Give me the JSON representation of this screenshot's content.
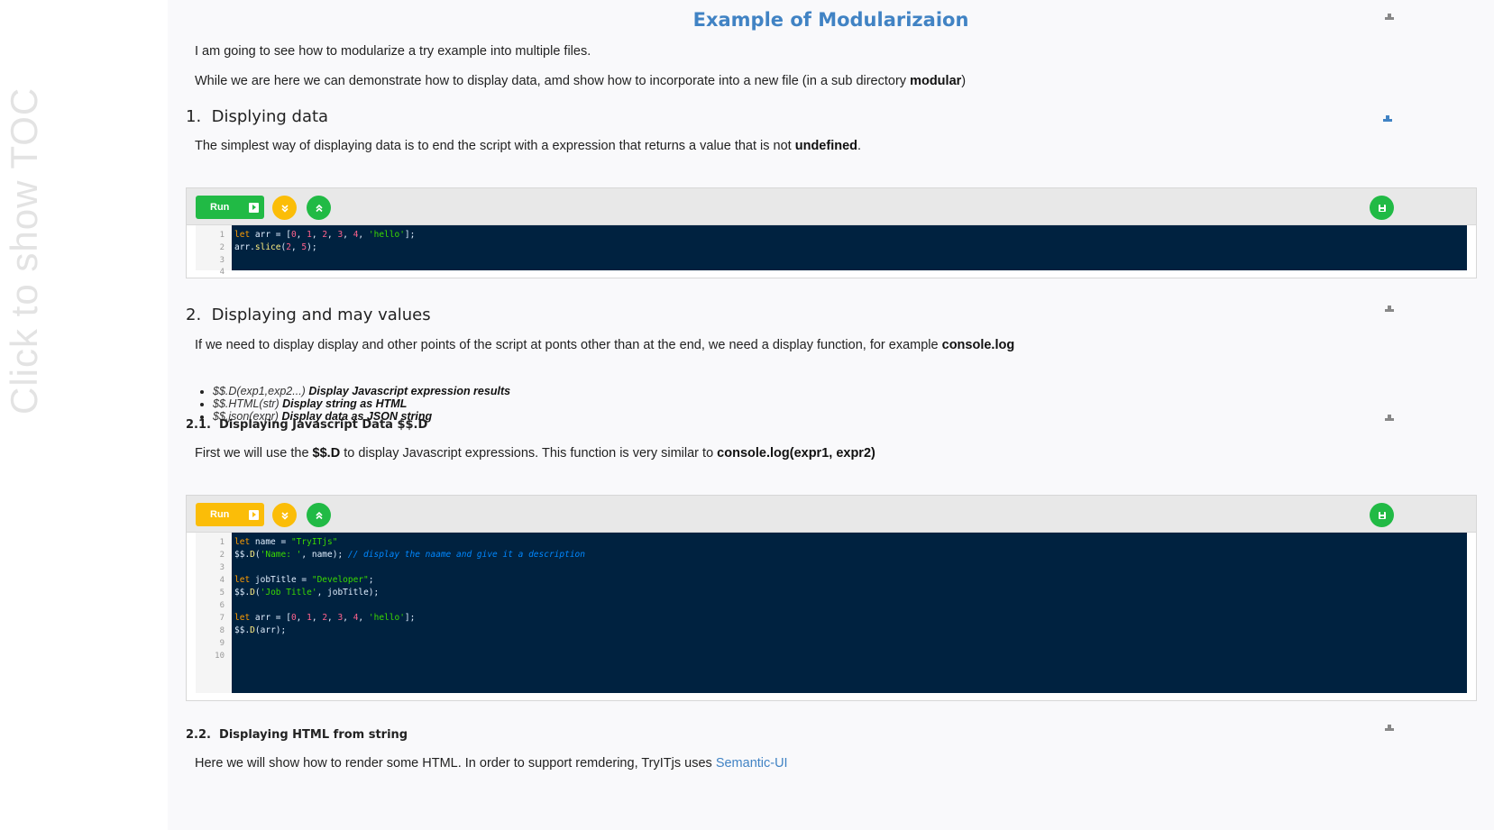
{
  "toc": {
    "label": "Click to show TOC"
  },
  "page_title": "Example of Modularizaion",
  "intro": {
    "p1": "I am going to see how to modularize a try example into multiple files.",
    "p2_before": "While we are here we can demonstrate how to display data, amd show how to incorporate into a new file (in a sub directory ",
    "p2_bold": "modular",
    "p2_after": ")"
  },
  "section1": {
    "number": "1.",
    "title": "Displying data",
    "text_before": "The simplest way of displaying data is to end the script with a expression that returns a value that is not ",
    "text_bold": "undefined",
    "text_after": "."
  },
  "editor1": {
    "run_label": "Run",
    "run_color": "#21ba45",
    "line_numbers": [
      "1",
      "2",
      "3",
      "4"
    ],
    "lines": [
      [
        "let",
        " arr = [",
        "0",
        ", ",
        "1",
        ", ",
        "2",
        ", ",
        "3",
        ", ",
        "4",
        ", ",
        "'hello'",
        "];"
      ],
      [
        "",
        "arr.",
        "slice",
        "(",
        "2",
        ", ",
        "5",
        ");"
      ]
    ]
  },
  "section2": {
    "number": "2.",
    "title": "Displaying and may values",
    "text_before": "If we need to display display and other points of the script at ponts other than at the end, we need a display function, for example ",
    "text_bold": "console.log",
    "bullets": [
      {
        "fn": "$$.D(exp1,exp2...)",
        "desc": "Display Javascript expression results"
      },
      {
        "fn": "$$.HTML(str)",
        "desc": "Display string as HTML"
      },
      {
        "fn": "$$.json(expr)",
        "desc": "Display data as JSON string"
      }
    ]
  },
  "section21": {
    "number": "2.1.",
    "title": "Displaying Javascript Data $$.D",
    "text_before": "First we will use the ",
    "text_bold1": "$$.D",
    "text_mid": " to display Javascript expressions. This function is very similar to ",
    "text_bold2": "console.log(expr1, expr2)"
  },
  "editor2": {
    "run_label": "Run",
    "run_color": "#fbbd08",
    "line_numbers": [
      "1",
      "2",
      "3",
      "4",
      "5",
      "6",
      "7",
      "8",
      "9",
      "10"
    ],
    "code_lines": [
      "let name = \"TryITjs\"",
      "$$.D('Name: ', name); // display the naame and give it a description",
      "",
      "let jobTitle = \"Developer\";",
      "$$.D('Job Title', jobTitle);",
      "",
      "let arr = [0, 1, 2, 3, 4, 'hello'];",
      "$$.D(arr);",
      "",
      ""
    ]
  },
  "section22": {
    "number": "2.2.",
    "title": "Displaying HTML from string",
    "text_before": "Here we will show how to render some HTML. In order to support remdering, TryITjs uses ",
    "link": "Semantic-UI"
  },
  "colors": {
    "title_blue": "#4183c4",
    "editor_bg": "#002240",
    "green": "#21ba45",
    "yellow": "#fbbd08"
  }
}
